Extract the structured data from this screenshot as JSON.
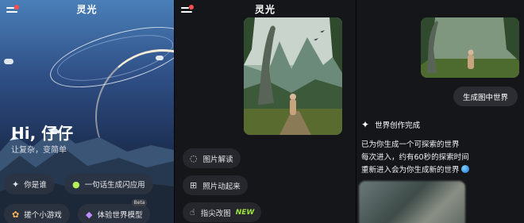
{
  "app": {
    "title": "灵光"
  },
  "home": {
    "greeting": "Hi, 仔仔",
    "slogan": "让复杂，变简单",
    "chips": [
      {
        "label": "你是谁",
        "icon": "sparkle-icon"
      },
      {
        "label": "一句话生成闪应用",
        "icon": "flash-app-icon"
      },
      {
        "label": "搓个小游戏",
        "icon": "game-icon"
      },
      {
        "label": "体验世界模型",
        "icon": "world-model-icon",
        "badge": "Beta"
      }
    ]
  },
  "tools": {
    "items": [
      {
        "label": "图片解读",
        "icon": "image-chat-icon"
      },
      {
        "label": "照片动起来",
        "icon": "photo-animate-icon"
      },
      {
        "label": "指尖改图",
        "icon": "finger-edit-icon",
        "badge": "NEW"
      }
    ]
  },
  "chat": {
    "user_message": "生成图中世界",
    "status": "世界创作完成",
    "reply_lines": [
      "已为你生成一个可探索的世界",
      "每次进入，约有60秒的探索时间",
      "重新进入会为你生成新的世界"
    ]
  },
  "colors": {
    "accent_new": "#9be23a",
    "notify_dot": "#ff4d4d"
  }
}
